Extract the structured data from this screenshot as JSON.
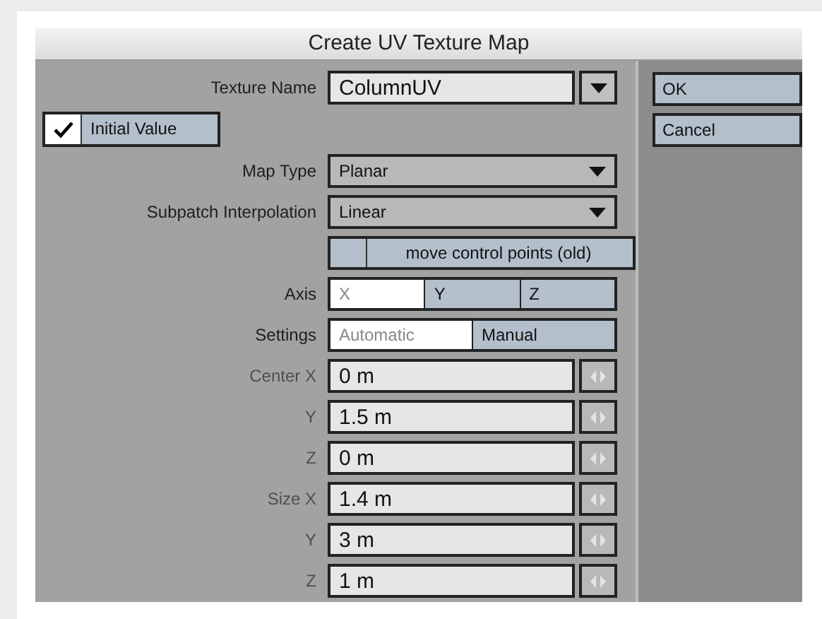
{
  "window": {
    "title": "Create UV Texture Map"
  },
  "texture_name": {
    "label": "Texture Name",
    "value": "ColumnUV"
  },
  "initial_value": {
    "label": "Initial Value",
    "checked": true
  },
  "map_type": {
    "label": "Map Type",
    "value": "Planar"
  },
  "subpatch_interpolation": {
    "label": "Subpatch Interpolation",
    "value": "Linear"
  },
  "move_control_points": {
    "label": "move control points (old)",
    "checked": false
  },
  "axis": {
    "label": "Axis",
    "options": [
      {
        "label": "X",
        "selected": true
      },
      {
        "label": "Y",
        "selected": false
      },
      {
        "label": "Z",
        "selected": false
      }
    ]
  },
  "settings": {
    "label": "Settings",
    "options": [
      {
        "label": "Automatic",
        "selected": true
      },
      {
        "label": "Manual",
        "selected": false
      }
    ]
  },
  "numeric_fields": [
    {
      "label": "Center X",
      "value": "0 m",
      "disabled": true
    },
    {
      "label": "Y",
      "value": "1.5 m",
      "disabled": true
    },
    {
      "label": "Z",
      "value": "0 m",
      "disabled": true
    },
    {
      "label": "Size X",
      "value": "1.4 m",
      "disabled": true
    },
    {
      "label": "Y",
      "value": "3 m",
      "disabled": true
    },
    {
      "label": "Z",
      "value": "1 m",
      "disabled": true
    }
  ],
  "buttons": [
    "OK",
    "Cancel"
  ]
}
